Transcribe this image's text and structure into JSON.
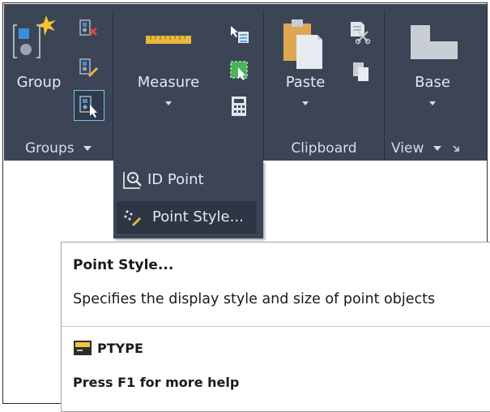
{
  "groups_panel": {
    "group_label": "Group",
    "title": "Groups",
    "icons": [
      "group-icon",
      "ungroup-icon",
      "group-edit-icon",
      "group-selection-icon"
    ]
  },
  "utilities_panel": {
    "measure_label": "Measure",
    "icons": [
      "measure-icon",
      "quick-select-icon",
      "select-all-icon",
      "quick-calc-icon"
    ],
    "dropdown": [
      {
        "label": "ID Point",
        "icon": "id-point-icon"
      },
      {
        "label": "Point Style...",
        "icon": "point-style-icon"
      }
    ]
  },
  "clipboard_panel": {
    "paste_label": "Paste",
    "title": "Clipboard",
    "icons": [
      "paste-icon",
      "cut-icon",
      "copy-icon"
    ]
  },
  "view_panel": {
    "base_label": "Base",
    "title": "View",
    "icons": [
      "base-view-icon",
      "dialog-launcher-icon"
    ]
  },
  "tooltip": {
    "title": "Point Style...",
    "description": "Specifies the display style and size of point objects",
    "command": "PTYPE",
    "command_icon": "ptype-command-icon",
    "help": "Press F1 for more help"
  },
  "colors": {
    "ribbon_bg": "#3c4555",
    "ribbon_text": "#e3e8ef",
    "highlight": "#2e3645",
    "tooltip_bg": "#ffffff"
  }
}
